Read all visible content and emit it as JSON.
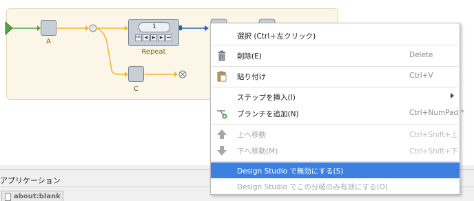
{
  "flow": {
    "nodes": {
      "a_label": "A",
      "repeat_label": "Repeat",
      "repeat_counter": "1",
      "c_label": "C"
    }
  },
  "context_menu": {
    "items": [
      {
        "label": "選択 (Ctrl＋左クリック)",
        "shortcut": "",
        "icon": "none",
        "enabled": true
      },
      {
        "label": "削除(E)",
        "shortcut": "Delete",
        "icon": "trash-icon",
        "enabled": true
      },
      {
        "label": "貼り付け",
        "shortcut": "Ctrl+V",
        "icon": "clipboard-icon",
        "enabled": true
      },
      {
        "label": "ステップを挿入(I)",
        "shortcut": "",
        "icon": "none",
        "enabled": true,
        "submenu": true
      },
      {
        "label": "ブランチを追加(N)",
        "shortcut": "Ctrl+NumPad *",
        "icon": "add-branch-icon",
        "enabled": true
      },
      {
        "label": "上へ移動",
        "shortcut": "Ctrl+Shift+上",
        "icon": "move-up-icon",
        "enabled": false
      },
      {
        "label": "下へ移動(M)",
        "shortcut": "Ctrl+Shift+下",
        "icon": "move-down-icon",
        "enabled": false
      },
      {
        "label": "Design Studio で無効にする(S)",
        "shortcut": "",
        "icon": "none",
        "enabled": true,
        "selected": true
      },
      {
        "label": "Design Studio でこの分岐のみ有効にする(O)",
        "shortcut": "",
        "icon": "none",
        "enabled": false
      }
    ]
  },
  "bottom_panel": {
    "title": "アプリケーション",
    "tab_label": "about:blank"
  },
  "colors": {
    "selection": "#3d80df",
    "flow_background": "#fcf6e8",
    "node_fill": "#c7ced6",
    "connector_orange": "#f0b429",
    "connector_green": "#58a043",
    "connector_blue": "#2a5db0"
  }
}
